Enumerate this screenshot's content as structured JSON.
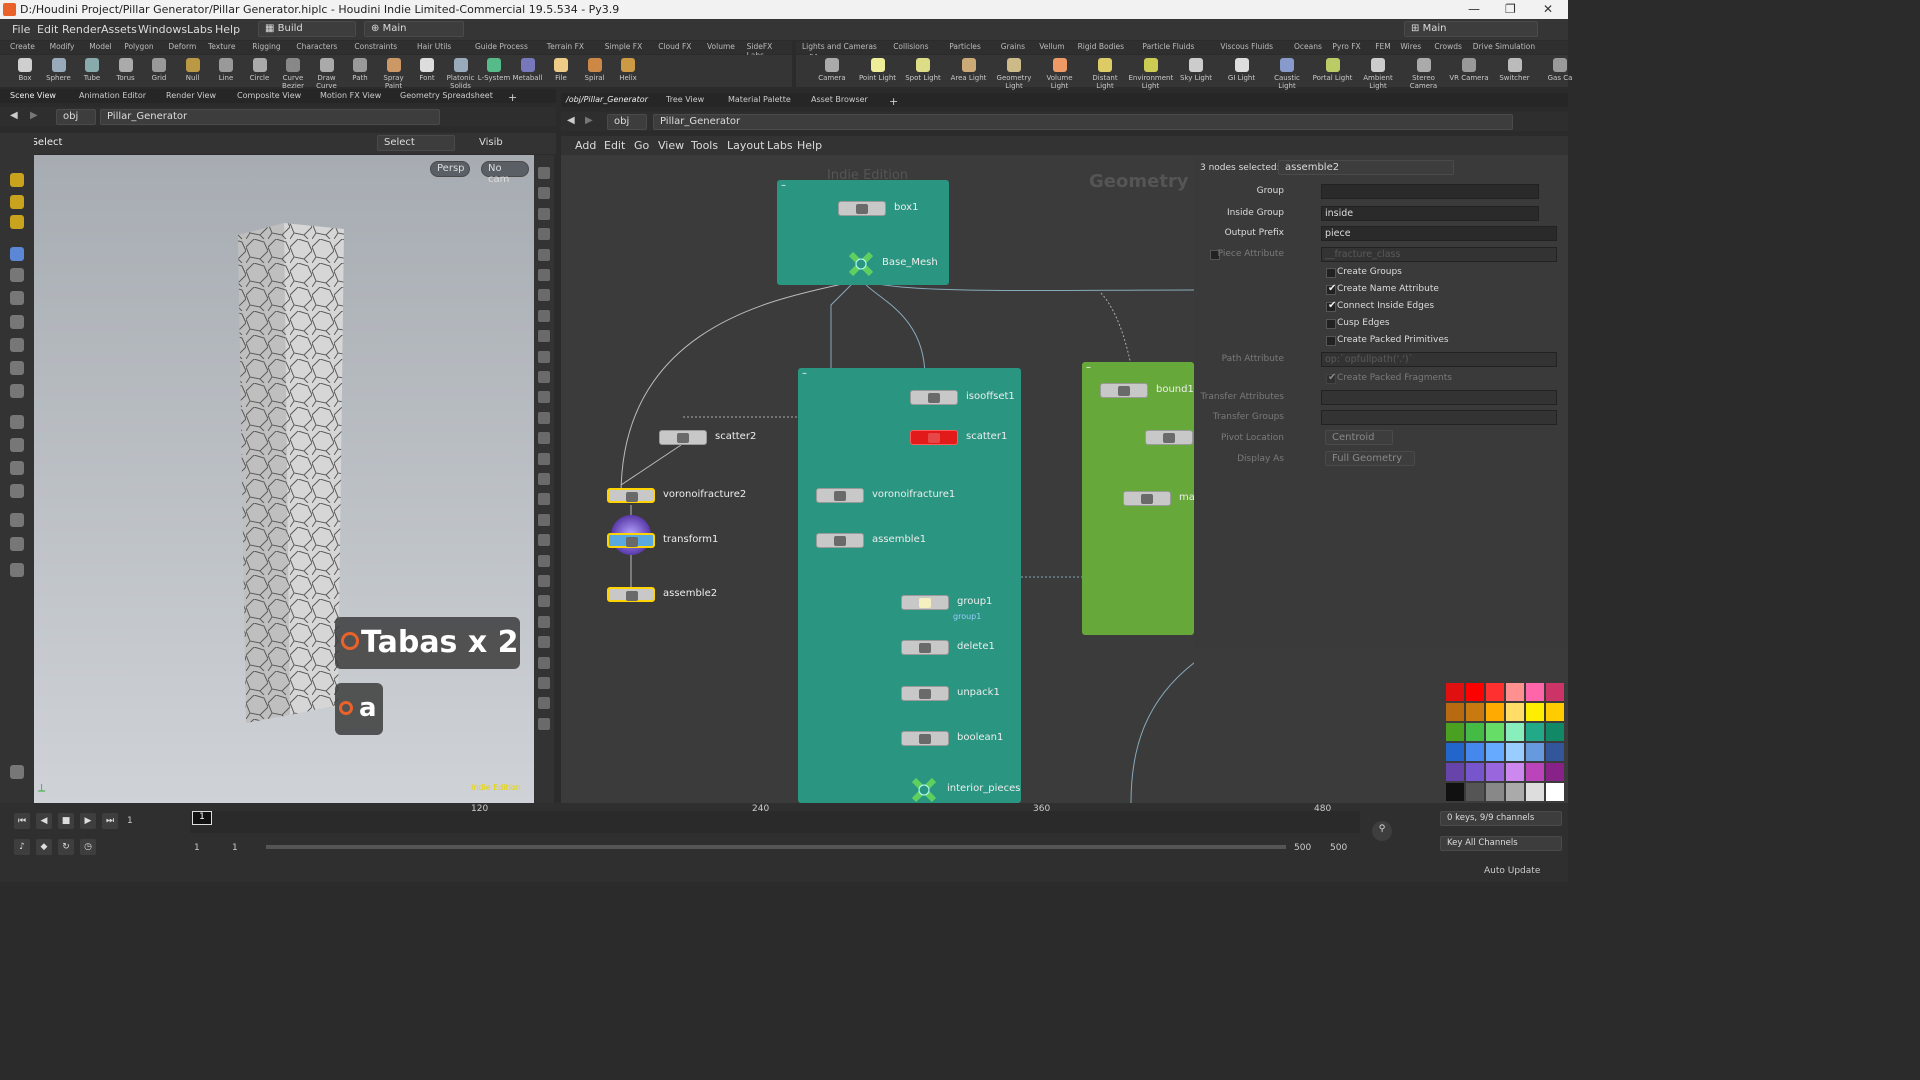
{
  "window": {
    "title": "D:/Houdini Project/Pillar Generator/Pillar Generator.hiplc - Houdini Indie Limited-Commercial 19.5.534 - Py3.9"
  },
  "menu": [
    "File",
    "Edit",
    "Render",
    "Assets",
    "Windows",
    "Labs",
    "Help"
  ],
  "desktop": {
    "build": "Build",
    "main": "Main",
    "right": "Main"
  },
  "shelf_tabs_left": [
    "Create",
    "Modify",
    "Model",
    "Polygon",
    "Deform",
    "Texture",
    "Rigging",
    "Characters",
    "Constraints",
    "Hair Utils",
    "Guide Process",
    "Terrain FX",
    "Simple FX",
    "Cloud FX",
    "Volume",
    "SideFX Labs",
    "Pyro FX"
  ],
  "shelf_tools_left": [
    "Box",
    "Sphere",
    "Tube",
    "Torus",
    "Grid",
    "Null",
    "Line",
    "Circle",
    "Curve Bezier",
    "Draw Curve",
    "Path",
    "Spray Paint",
    "Font",
    "Platonic Solids",
    "L-System",
    "Metaball",
    "File",
    "Spiral",
    "Helix"
  ],
  "shelf_tabs_right": [
    "Lights and Cameras",
    "Collisions",
    "Particles",
    "Grains",
    "Vellum",
    "Rigid Bodies",
    "Particle Fluids",
    "Viscous Fluids",
    "Oceans",
    "Pyro FX",
    "FEM",
    "Wires",
    "Crowds",
    "Drive Simulation"
  ],
  "shelf_tools_right": [
    "Camera",
    "Point Light",
    "Spot Light",
    "Area Light",
    "Geometry Light",
    "Volume Light",
    "Distant Light",
    "Environment Light",
    "Sky Light",
    "GI Light",
    "Caustic Light",
    "Portal Light",
    "Ambient Light",
    "Stereo Camera",
    "VR Camera",
    "Switcher",
    "Gas Ca"
  ],
  "left_pane_tabs": [
    "Scene View",
    "Animation Editor",
    "Render View",
    "Composite View",
    "Motion FX View",
    "Geometry Spreadsheet"
  ],
  "right_pane_tabs": [
    "/obj/Pillar_Generator",
    "Tree View",
    "Material Palette",
    "Asset Browser"
  ],
  "path": {
    "obj": "obj",
    "node": "Pillar_Generator"
  },
  "viewer": {
    "select": "Select",
    "select_mode": "Select",
    "visib": "Visib",
    "persp": "Persp",
    "cam": "No cam",
    "watermark": "Indie Edition"
  },
  "overlay": {
    "big": "Tabas x 2",
    "small": "a"
  },
  "network_menu": [
    "Add",
    "Edit",
    "Go",
    "View",
    "Tools",
    "Layout",
    "Labs",
    "Help"
  ],
  "network": {
    "watermark": "Indie Edition",
    "context": "Geometry",
    "nodes": {
      "box1": "box1",
      "base_mesh": "Base_Mesh",
      "isooffset1": "isooffset1",
      "scatter1": "scatter1",
      "scatter2": "scatter2",
      "voronoifracture2": "voronoifracture2",
      "transform1": "transform1",
      "assemble2": "assemble2",
      "voronoifracture1": "voronoifracture1",
      "assemble1": "assemble1",
      "group1": "group1",
      "group1_sub": "group1",
      "delete1": "delete1",
      "unpack1": "unpack1",
      "boolean1": "boolean1",
      "interior_pieces": "interior_pieces",
      "bound1": "bound1",
      "match": "matc"
    }
  },
  "params": {
    "selected_label": "3 nodes selected:",
    "selected_node": "assemble2",
    "group_label": "Group",
    "group_value": "",
    "inside_group_label": "Inside Group",
    "inside_group_value": "inside",
    "output_prefix_label": "Output Prefix",
    "output_prefix_value": "piece",
    "piece_attr_label": "Piece Attribute",
    "piece_attr_value": "__fracture_class",
    "create_groups": "Create Groups",
    "create_name_attr": "Create Name Attribute",
    "connect_inside_edges": "Connect Inside Edges",
    "cusp_edges": "Cusp Edges",
    "create_packed_primitives": "Create Packed Primitives",
    "path_attr_label": "Path Attribute",
    "path_attr_value": "op:`opfullpath('.')`",
    "create_packed_fragments": "Create Packed Fragments",
    "transfer_attributes": "Transfer Attributes",
    "transfer_groups": "Transfer Groups",
    "pivot_location_label": "Pivot Location",
    "pivot_location_value": "Centroid",
    "display_as_label": "Display As",
    "display_as_value": "Full Geometry"
  },
  "palette": [
    "#e01010",
    "#ff0000",
    "#ff3030",
    "#ff9090",
    "#ff66aa",
    "#cc3366",
    "#b86a10",
    "#c87a10",
    "#ffaa00",
    "#ffdd66",
    "#ffee00",
    "#ffcc00",
    "#4aa020",
    "#44bb44",
    "#66dd66",
    "#88eebb",
    "#22aa88",
    "#118866",
    "#2266cc",
    "#4488ee",
    "#66aaff",
    "#99ccff",
    "#6699dd",
    "#335599",
    "#6644aa",
    "#7755cc",
    "#9966dd",
    "#cc88ee",
    "#bb44bb",
    "#882288",
    "#111111",
    "#555555",
    "#888888",
    "#aaaaaa",
    "#dddddd",
    "#ffffff"
  ],
  "timeline": {
    "frame": "1",
    "ticks": [
      "120",
      "240",
      "360",
      "480"
    ],
    "frame_marker": "1",
    "range_start": "1",
    "range_start2": "1",
    "range_end": "500",
    "range_end2": "500",
    "keys": "0 keys, 9/9 channels",
    "key_all": "Key All Channels",
    "auto_update": "Auto Update"
  }
}
